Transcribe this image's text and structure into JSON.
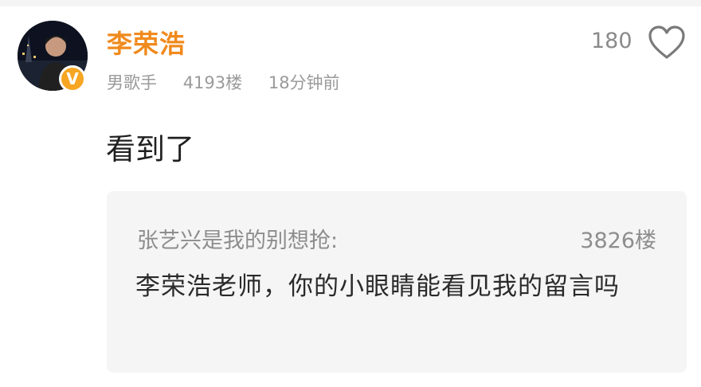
{
  "comment": {
    "username": "李荣浩",
    "badge": "V",
    "tag": "男歌手",
    "floor": "4193楼",
    "time": "18分钟前",
    "likes": "180",
    "text": "看到了",
    "icons": [
      "heart-icon",
      "verified-icon"
    ],
    "colors": {
      "username": "#f08a1d",
      "badge": "#f6a623"
    }
  },
  "quoted": {
    "author": "张艺兴是我的别想抢:",
    "floor": "3826楼",
    "text": "李荣浩老师，你的小眼睛能看见我的留言吗"
  }
}
